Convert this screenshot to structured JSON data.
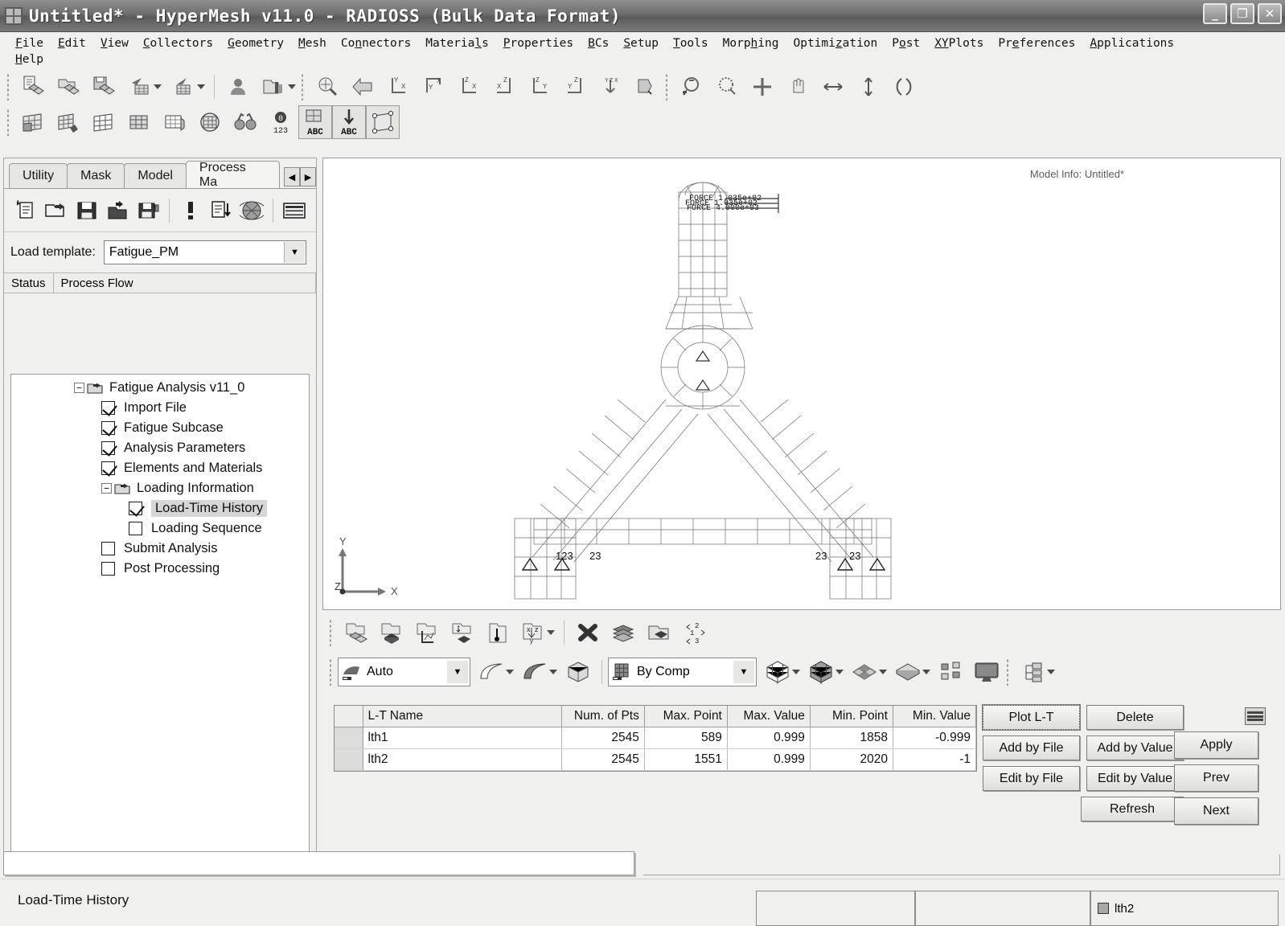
{
  "window": {
    "title": "Untitled* - HyperMesh v11.0 - RADIOSS (Bulk Data Format)",
    "icon": "hypermesh-app-icon",
    "minimize_label": "_",
    "restore_label": "❐",
    "close_label": "✕"
  },
  "menubar": {
    "row1": [
      {
        "label": "File",
        "mnemonic": "F"
      },
      {
        "label": "Edit",
        "mnemonic": "E"
      },
      {
        "label": "View",
        "mnemonic": "V"
      },
      {
        "label": "Collectors",
        "mnemonic": "C"
      },
      {
        "label": "Geometry",
        "mnemonic": "G"
      },
      {
        "label": "Mesh",
        "mnemonic": "M"
      },
      {
        "label": "Connectors",
        "mnemonic": "n"
      },
      {
        "label": "Materials",
        "mnemonic": "l"
      },
      {
        "label": "Properties",
        "mnemonic": "P"
      },
      {
        "label": "BCs",
        "mnemonic": "B"
      },
      {
        "label": "Setup",
        "mnemonic": "S"
      },
      {
        "label": "Tools",
        "mnemonic": "T"
      },
      {
        "label": "Morphing",
        "mnemonic": "h"
      },
      {
        "label": "Optimization",
        "mnemonic": "z"
      },
      {
        "label": "Post",
        "mnemonic": "o"
      },
      {
        "label": "XYPlots",
        "mnemonic": "XY"
      },
      {
        "label": "Preferences",
        "mnemonic": "e"
      },
      {
        "label": "Applications",
        "mnemonic": "A"
      }
    ],
    "row2": [
      {
        "label": "Help",
        "mnemonic": "H"
      }
    ]
  },
  "toolbar_top": {
    "icons": [
      "new-model-icon",
      "open-model-icon",
      "save-model-icon",
      "import-model-icon",
      "export-model-icon",
      "user-profiles-icon",
      "load-userpage-icon",
      "fit-view-icon",
      "undo-view-icon",
      "xy-view-icon",
      "yx-view-icon",
      "zx-view-icon",
      "xz-view-icon",
      "zy-view-icon",
      "yz-view-icon",
      "isometric-view-icon",
      "left-view-icon",
      "zoom-out-icon",
      "zoom-in-icon",
      "circle-zoom-icon",
      "pan-icon",
      "arrow-horizontal-icon",
      "arrow-vertical-icon",
      "rotate-icon"
    ]
  },
  "toolbar_second": {
    "icons": [
      "shaded-elements-icon",
      "shaded-elements-edges-icon",
      "wireframe-icon",
      "mesh-lines-icon",
      "transparent-mesh-icon",
      "feature-lines-icon",
      "find-icon",
      "number-id-icon",
      "mesh-abc-icon",
      "project-abc-icon",
      "node-edit-icon"
    ]
  },
  "left_panel": {
    "tabs": [
      {
        "label": "Utility",
        "active": false
      },
      {
        "label": "Mask",
        "active": false
      },
      {
        "label": "Model",
        "active": false
      },
      {
        "label": "Process Ma",
        "active": true
      }
    ],
    "tab_nav_prev": "◀",
    "tab_nav_next": "▶",
    "close": "✕",
    "toolbar_icons": [
      "new-process-icon",
      "open-process-icon",
      "save-process-icon",
      "import-process-icon",
      "save-as-process-icon",
      "run-task-icon",
      "report-icon",
      "globe-icon",
      "table-view-icon"
    ],
    "load_template": {
      "label": "Load template:",
      "value": "Fatigue_PM",
      "dropdown_arrow": "▼"
    },
    "tree_columns": [
      "Status",
      "Process Flow"
    ],
    "tree": [
      {
        "label": "Fatigue Analysis v11_0",
        "depth": 0,
        "type": "folder",
        "expanded": true,
        "checked": null,
        "selected": false
      },
      {
        "label": "Import File",
        "depth": 1,
        "type": "task",
        "checked": true,
        "selected": false
      },
      {
        "label": "Fatigue Subcase",
        "depth": 1,
        "type": "task",
        "checked": true,
        "selected": false
      },
      {
        "label": "Analysis Parameters",
        "depth": 1,
        "type": "task",
        "checked": true,
        "selected": false
      },
      {
        "label": "Elements and Materials",
        "depth": 1,
        "type": "task",
        "checked": true,
        "selected": false
      },
      {
        "label": "Loading Information",
        "depth": 1,
        "type": "folder",
        "expanded": true,
        "checked": null,
        "selected": false
      },
      {
        "label": "Load-Time History",
        "depth": 2,
        "type": "task",
        "checked": true,
        "selected": true
      },
      {
        "label": "Loading Sequence",
        "depth": 2,
        "type": "task",
        "checked": false,
        "selected": false
      },
      {
        "label": "Submit Analysis",
        "depth": 1,
        "type": "task",
        "checked": false,
        "selected": false
      },
      {
        "label": "Post Processing",
        "depth": 1,
        "type": "task",
        "checked": false,
        "selected": false
      }
    ]
  },
  "viewport": {
    "model_info": "Model Info: Untitled*",
    "axes": {
      "x": "X",
      "y": "Y",
      "z": "Z"
    },
    "load_labels": [
      "FORCE 1.035e+02",
      "FORCE 1.035e+02",
      "FORCE 4.000e+03"
    ],
    "constraint_labels": [
      "123",
      "23",
      "23",
      "23"
    ]
  },
  "mid_toolbar": {
    "row1_icons": [
      "create-set-icon",
      "create-block-icon",
      "contour-icon",
      "temperature-icon",
      "thickness-icon",
      "vector-plot-icon",
      "delete-icon",
      "stack-icon",
      "folder-add-icon",
      "renumber-icon"
    ],
    "row2": {
      "display_mode": {
        "value": "Auto",
        "icon": "auto-shade-icon",
        "arrow": "▼"
      },
      "surface_icons": [
        "surface-shade-icon",
        "surface-wire-icon",
        "solid-box-icon"
      ],
      "color_mode": {
        "value": "By Comp",
        "icon": "by-comp-icon",
        "arrow": "▼"
      },
      "trailing_icons": [
        "wire-cube-icon",
        "shaded-cube-icon",
        "faceted-icon",
        "plate-icon",
        "element-group-icon",
        "monitor-icon",
        "tree-view-icon"
      ]
    }
  },
  "table": {
    "columns": [
      "L-T Name",
      "Num. of Pts",
      "Max. Point",
      "Max. Value",
      "Min. Point",
      "Min. Value"
    ],
    "rows": [
      {
        "name": "lth1",
        "num_pts": "2545",
        "max_point": "589",
        "max_value": "0.999",
        "min_point": "1858",
        "min_value": "-0.999"
      },
      {
        "name": "lth2",
        "num_pts": "2545",
        "max_point": "1551",
        "max_value": "0.999",
        "min_point": "2020",
        "min_value": "-1"
      }
    ]
  },
  "buttons": {
    "plot_lt": "Plot L-T",
    "delete": "Delete",
    "add_by_file": "Add by File",
    "add_by_value": "Add by Value",
    "edit_by_file": "Edit by File",
    "edit_by_value": "Edit by Value",
    "refresh": "Refresh",
    "apply": "Apply",
    "prev": "Prev",
    "next": "Next",
    "list_icon": "list-view-icon"
  },
  "statusbar": {
    "message": "Load-Time History",
    "cell1": "",
    "cell2": "",
    "cell3": "lth2",
    "cell3_swatch": "#a8a8a8"
  }
}
